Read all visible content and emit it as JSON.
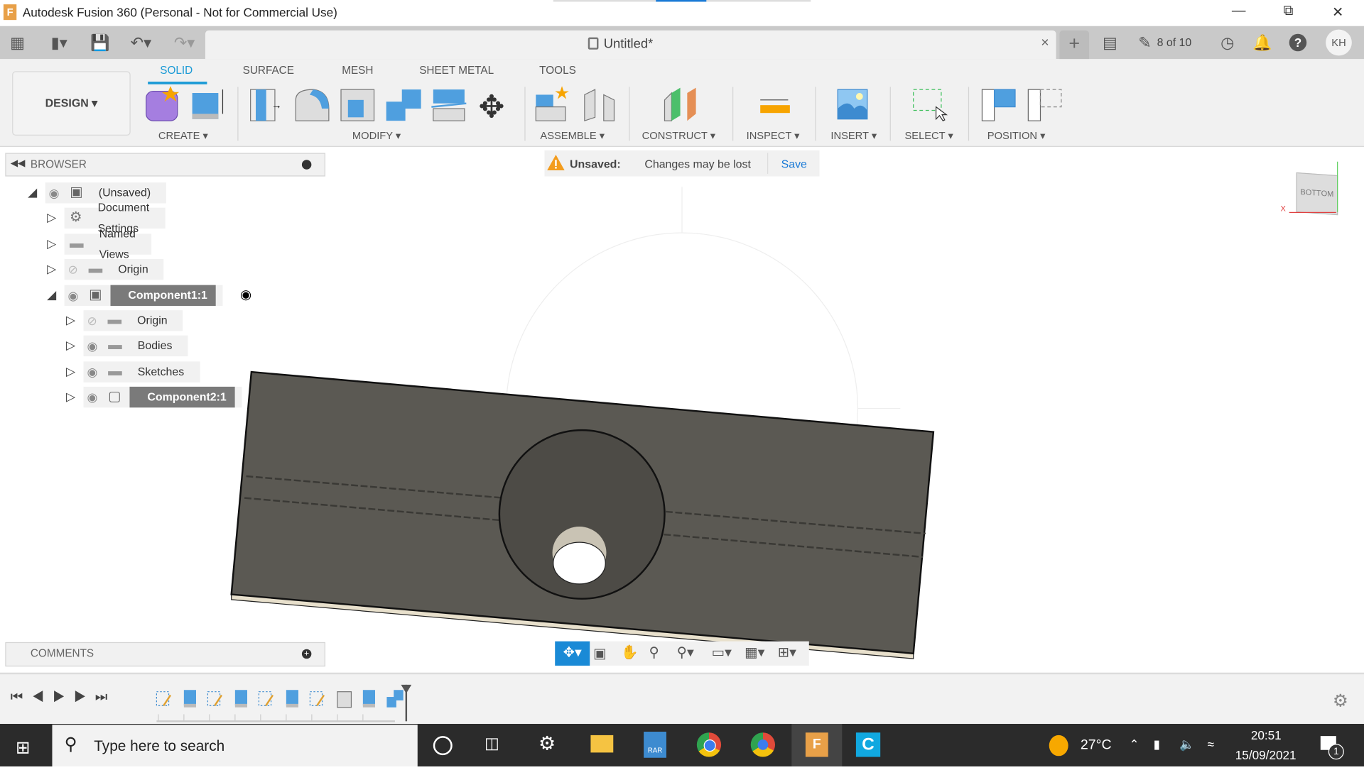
{
  "window": {
    "title": "Autodesk Fusion 360 (Personal - Not for Commercial Use)",
    "app_icon": "F"
  },
  "document_tab": {
    "name": "Untitled*",
    "close": "×",
    "new_tab": "+"
  },
  "header_right": {
    "jobs": "8 of 10",
    "user_initials": "KH"
  },
  "workspace": {
    "label": "DESIGN ▾"
  },
  "ribbon_tabs": [
    {
      "label": "SOLID",
      "active": true
    },
    {
      "label": "SURFACE"
    },
    {
      "label": "MESH"
    },
    {
      "label": "SHEET METAL"
    },
    {
      "label": "TOOLS"
    }
  ],
  "groups": {
    "create": "CREATE ▾",
    "modify": "MODIFY ▾",
    "assemble": "ASSEMBLE ▾",
    "construct": "CONSTRUCT ▾",
    "inspect": "INSPECT ▾",
    "insert": "INSERT ▾",
    "select": "SELECT ▾",
    "position": "POSITION ▾"
  },
  "browser": {
    "title": "BROWSER",
    "items": [
      {
        "label": "(Unsaved)",
        "expanded": true,
        "visible": true
      },
      {
        "label": "Document Settings"
      },
      {
        "label": "Named Views"
      },
      {
        "label": "Origin",
        "visible": false
      },
      {
        "label": "Component1:1",
        "expanded": true,
        "visible": true,
        "selected": true
      },
      {
        "label": "Origin",
        "visible": false
      },
      {
        "label": "Bodies",
        "visible": true
      },
      {
        "label": "Sketches",
        "visible": true
      },
      {
        "label": "Component2:1",
        "visible": true,
        "selected": true
      }
    ]
  },
  "notice": {
    "title": "Unsaved:",
    "message": "Changes may be lost",
    "action": "Save"
  },
  "viewcube": {
    "face": "BOTTOM",
    "x_axis": "X"
  },
  "comments": {
    "title": "COMMENTS"
  },
  "taskbar": {
    "search_placeholder": "Type here to search",
    "weather": "27°C",
    "time": "20:51",
    "date": "15/09/2021",
    "notifications": "1",
    "rar": "RAR"
  },
  "colors": {
    "accent": "#1a9ad6",
    "body": "#5b5953",
    "edge": "#e8e0cc",
    "warning": "#f39c1e"
  }
}
